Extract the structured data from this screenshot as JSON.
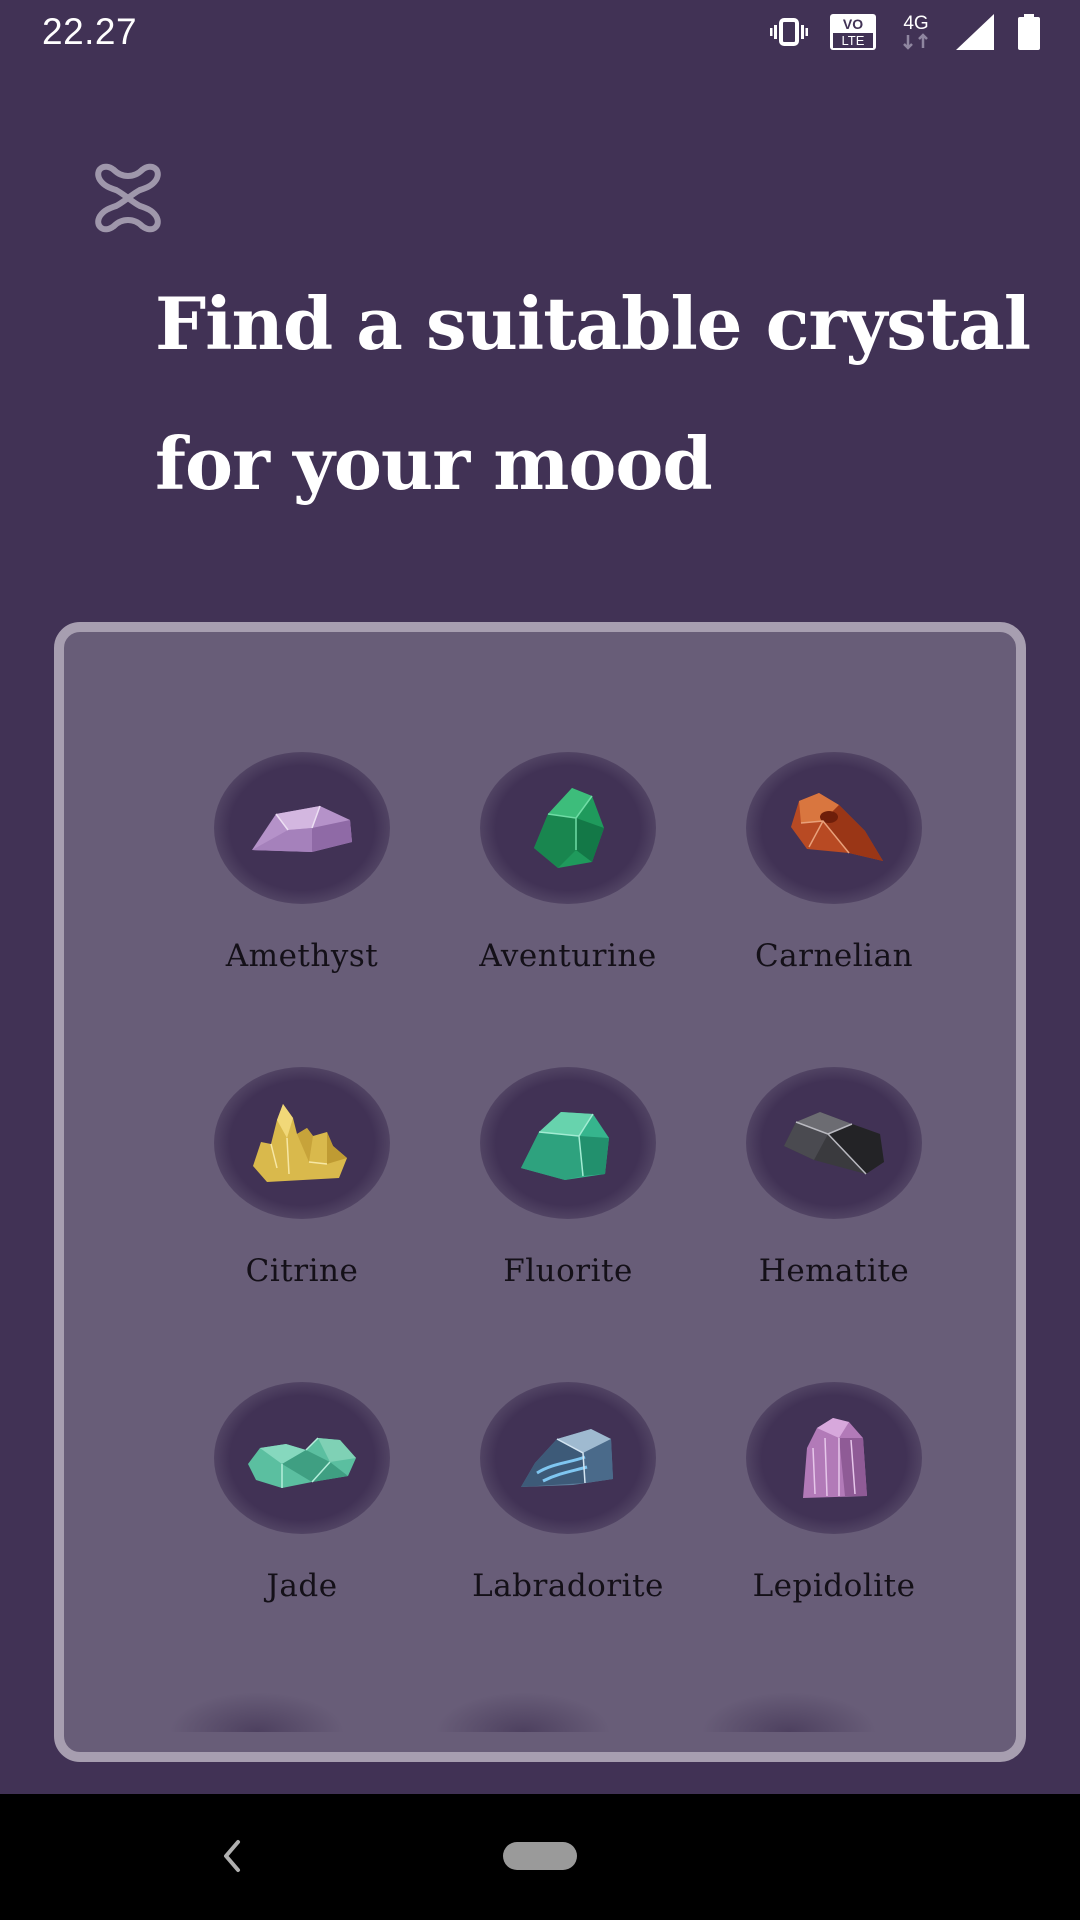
{
  "status_bar": {
    "time": "22.27",
    "icons": [
      "vibrate-icon",
      "volte-icon",
      "4g-data-icon",
      "signal-icon",
      "battery-icon"
    ],
    "volte_text_top": "VO",
    "volte_text_bottom": "LTE",
    "network_text": "4G"
  },
  "header": {
    "logo_icon": "knot-logo-icon",
    "headline_bold": "Find",
    "headline_rest": " a suitable crystal",
    "headline_line2": "for your mood"
  },
  "crystals": [
    {
      "name": "Amethyst",
      "color": "#b592c9"
    },
    {
      "name": "Aventurine",
      "color": "#1f9a5c"
    },
    {
      "name": "Carnelian",
      "color": "#b84a23"
    },
    {
      "name": "Citrine",
      "color": "#d9b94c"
    },
    {
      "name": "Fluorite",
      "color": "#36b58d"
    },
    {
      "name": "Hematite",
      "color": "#3a3a3e"
    },
    {
      "name": "Jade",
      "color": "#5bbfa0"
    },
    {
      "name": "Labradorite",
      "color": "#5e7f9d"
    },
    {
      "name": "Lepidolite",
      "color": "#b27ab8"
    }
  ],
  "colors": {
    "background": "#413255",
    "card": "#685d78",
    "card_border": "#a79eb0",
    "label_text": "#141018"
  },
  "nav_bar": {
    "icons": [
      "back-icon",
      "home-pill"
    ]
  }
}
